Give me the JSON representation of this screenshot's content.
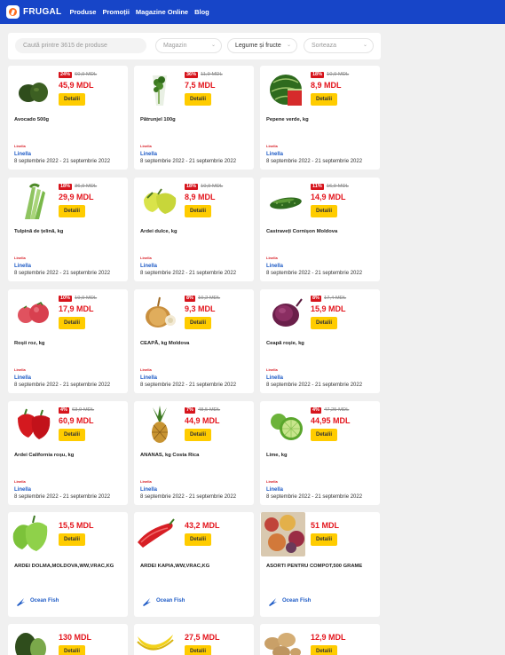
{
  "nav": {
    "brand": "FRUGAL",
    "links": [
      "Produse",
      "Promoții",
      "Magazine Online",
      "Blog"
    ]
  },
  "filters": {
    "search_placeholder": "Caută printre 3615 de produse",
    "store": "Magazin",
    "category": "Legume și fructe",
    "sort": "Sorteaza"
  },
  "button_label": "Detalii",
  "products": [
    {
      "name": "Avocado 500g",
      "discount": "24%",
      "old_price": "60,9 MDL",
      "price": "45,9 MDL",
      "store": "Linella",
      "dates": "8 septembrie 2022 - 21 septembrie 2022"
    },
    {
      "name": "Pătrunjel 100g",
      "discount": "36%",
      "old_price": "11,9 MDL",
      "price": "7,5 MDL",
      "store": "Linella",
      "dates": "8 septembrie 2022 - 21 septembrie 2022"
    },
    {
      "name": "Pepene verde, kg",
      "discount": "18%",
      "old_price": "10,9 MDL",
      "price": "8,9 MDL",
      "store": "Linella",
      "dates": "8 septembrie 2022 - 21 septembrie 2022"
    },
    {
      "name": "Tulpină de țelină, kg",
      "discount": "18%",
      "old_price": "36,9 MDL",
      "price": "29,9 MDL",
      "store": "Linella",
      "dates": "8 septembrie 2022 - 21 septembrie 2022"
    },
    {
      "name": "Ardei dulce, kg",
      "discount": "18%",
      "old_price": "10,9 MDL",
      "price": "8,9 MDL",
      "store": "Linella",
      "dates": "8 septembrie 2022 - 21 septembrie 2022"
    },
    {
      "name": "Castraveți Cornișon Moldova",
      "discount": "11%",
      "old_price": "16,9 MDL",
      "price": "14,9 MDL",
      "store": "Linella",
      "dates": "8 septembrie 2022 - 21 septembrie 2022"
    },
    {
      "name": "Roșii roz, kg",
      "discount": "10%",
      "old_price": "19,9 MDL",
      "price": "17,9 MDL",
      "store": "Linella",
      "dates": "8 septembrie 2022 - 21 septembrie 2022"
    },
    {
      "name": "CEAPĂ, kg  Moldova",
      "discount": "8%",
      "old_price": "10,2 MDL",
      "price": "9,3 MDL",
      "store": "Linella",
      "dates": "8 septembrie 2022 - 21 septembrie 2022"
    },
    {
      "name": "Ceapă roșie, kg",
      "discount": "8%",
      "old_price": "17,4 MDL",
      "price": "15,9 MDL",
      "store": "Linella",
      "dates": "8 septembrie 2022 - 21 septembrie 2022"
    },
    {
      "name": "Ardei California roșu, kg",
      "discount": "4%",
      "old_price": "63,9 MDL",
      "price": "60,9 MDL",
      "store": "Linella",
      "dates": "8 septembrie 2022 - 21 septembrie 2022"
    },
    {
      "name": "ANANAS, kg Costa Rica",
      "discount": "7%",
      "old_price": "48,5 MDL",
      "price": "44,9 MDL",
      "store": "Linella",
      "dates": "8 septembrie 2022 - 21 septembrie 2022"
    },
    {
      "name": "Lime, kg",
      "discount": "4%",
      "old_price": "47,25 MDL",
      "price": "44,95 MDL",
      "store": "Linella",
      "dates": "8 septembrie 2022 - 21 septembrie 2022"
    },
    {
      "name": "ARDEI DOLMA,MOLDOVA,WW,VRAC,KG",
      "price": "15,5 MDL",
      "store": "Ocean Fish"
    },
    {
      "name": "ARDEI KAPIA,WW,VRAC,KG",
      "price": "43,2 MDL",
      "store": "Ocean Fish"
    },
    {
      "name": "ASORTI PENTRU COMPOT,500 GRAME",
      "price": "51 MDL",
      "store": "Ocean Fish"
    },
    {
      "name": "",
      "price": "130 MDL"
    },
    {
      "name": "",
      "price": "27,5 MDL"
    },
    {
      "name": "",
      "price": "12,9 MDL"
    }
  ],
  "colors": {
    "nav": "#1745c8",
    "button": "#ffcc00",
    "price": "#e3141c",
    "store": "#1e5bc6"
  }
}
